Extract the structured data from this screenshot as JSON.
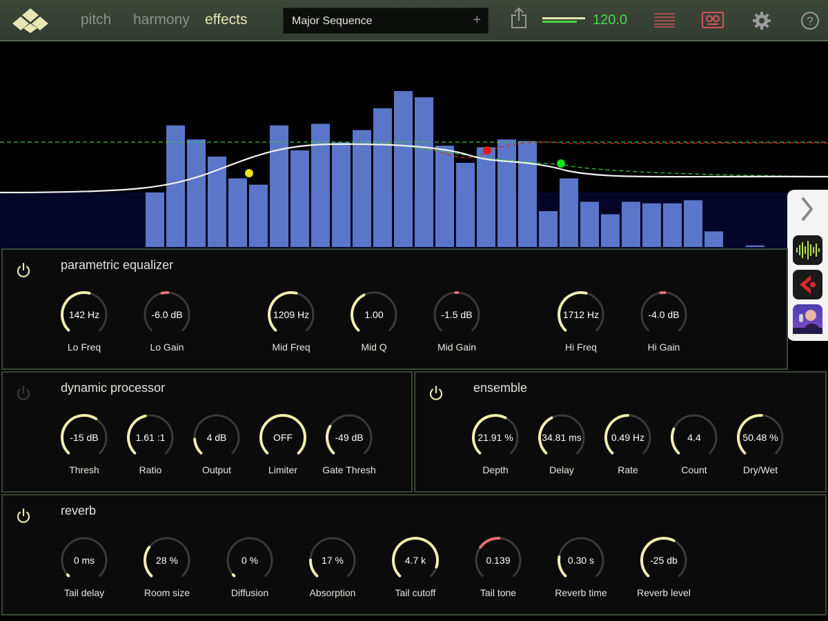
{
  "tabs": [
    {
      "label": "pitch",
      "active": false
    },
    {
      "label": "harmony",
      "active": false
    },
    {
      "label": "effects",
      "active": true
    }
  ],
  "preset": {
    "name": "Major Sequence",
    "add": "+"
  },
  "tempo": "120.0",
  "icons": [
    "share-icon",
    "tempo-meter-icon",
    "menu-lines-icon",
    "tape-icon",
    "gear-icon",
    "help-icon"
  ],
  "colors": {
    "accent": "#e7e6b4",
    "knob_arc": "#f2efb0",
    "knob_track": "#3a3a3a",
    "alert_arc": "#e36f78",
    "tempo": "#4dd84a"
  },
  "spectrum": {
    "bar_levels": [
      0,
      0,
      0,
      0,
      0,
      0,
      0,
      0.35,
      0.78,
      0.69,
      0.58,
      0.44,
      0.4,
      0.78,
      0.62,
      0.79,
      0.67,
      0.75,
      0.89,
      1.0,
      0.96,
      0.65,
      0.54,
      0.64,
      0.69,
      0.68,
      0.23,
      0.44,
      0.29,
      0.21,
      0.29,
      0.28,
      0.28,
      0.3,
      0.1,
      0,
      0.01,
      0
    ],
    "curve_points": [
      "yellow",
      "red",
      "green"
    ]
  },
  "sidebar_apps": [
    "waveform-app",
    "cubasis-app",
    "vocalive-app"
  ],
  "eq": {
    "title": "parametric equalizer",
    "knobs": [
      {
        "value": "142 Hz",
        "label": "Lo Freq",
        "fill": 0.55,
        "red": false
      },
      {
        "value": "-6.0 dB",
        "label": "Lo Gain",
        "fill": 0.45,
        "red": true
      },
      {
        "value": "1209 Hz",
        "label": "Mid Freq",
        "fill": 0.55,
        "red": false
      },
      {
        "value": "1.00",
        "label": "Mid Q",
        "fill": 0.4,
        "red": false
      },
      {
        "value": "-1.5 dB",
        "label": "Mid Gain",
        "fill": 0.49,
        "red": true
      },
      {
        "value": "1712 Hz",
        "label": "Hi Freq",
        "fill": 0.55,
        "red": false
      },
      {
        "value": "-4.0 dB",
        "label": "Hi Gain",
        "fill": 0.47,
        "red": true
      }
    ]
  },
  "dyn": {
    "title": "dynamic processor",
    "knobs": [
      {
        "value": "-15 dB",
        "label": "Thresh",
        "fill": 0.62,
        "red": false
      },
      {
        "value": "1.61 :1",
        "label": "Ratio",
        "fill": 0.45,
        "red": false
      },
      {
        "value": "4 dB",
        "label": "Output",
        "fill": 0.15,
        "red": false
      },
      {
        "value": "OFF",
        "label": "Limiter",
        "fill": 1.0,
        "red": false
      },
      {
        "value": "-49 dB",
        "label": "Gate Thresh",
        "fill": 0.28,
        "red": false
      }
    ]
  },
  "ens": {
    "title": "ensemble",
    "knobs": [
      {
        "value": "21.91 %",
        "label": "Depth",
        "fill": 0.6,
        "red": false
      },
      {
        "value": "34.81 ms",
        "label": "Delay",
        "fill": 0.4,
        "red": false
      },
      {
        "value": "0.49  Hz",
        "label": "Rate",
        "fill": 0.5,
        "red": false
      },
      {
        "value": "4.4",
        "label": "Count",
        "fill": 0.25,
        "red": false
      },
      {
        "value": "50.48 %",
        "label": "Dry/Wet",
        "fill": 0.51,
        "red": false
      }
    ]
  },
  "reverb": {
    "title": "reverb",
    "knobs": [
      {
        "value": "0 ms",
        "label": "Tail delay",
        "fill": 0.01,
        "red": false
      },
      {
        "value": "28 %",
        "label": "Room size",
        "fill": 0.3,
        "red": false
      },
      {
        "value": "0 %",
        "label": "Diffusion",
        "fill": 0.01,
        "red": false
      },
      {
        "value": "17 %",
        "label": "Absorption",
        "fill": 0.17,
        "red": false
      },
      {
        "value": "4.7 k",
        "label": "Tail cutoff",
        "fill": 0.9,
        "red": false
      },
      {
        "value": "0.139",
        "label": "Tail tone",
        "fill": 0.3,
        "red": true
      },
      {
        "value": "0.30 s",
        "label": "Reverb time",
        "fill": 0.2,
        "red": false
      },
      {
        "value": "-25 db",
        "label": "Reverb level",
        "fill": 0.6,
        "red": false
      }
    ]
  }
}
